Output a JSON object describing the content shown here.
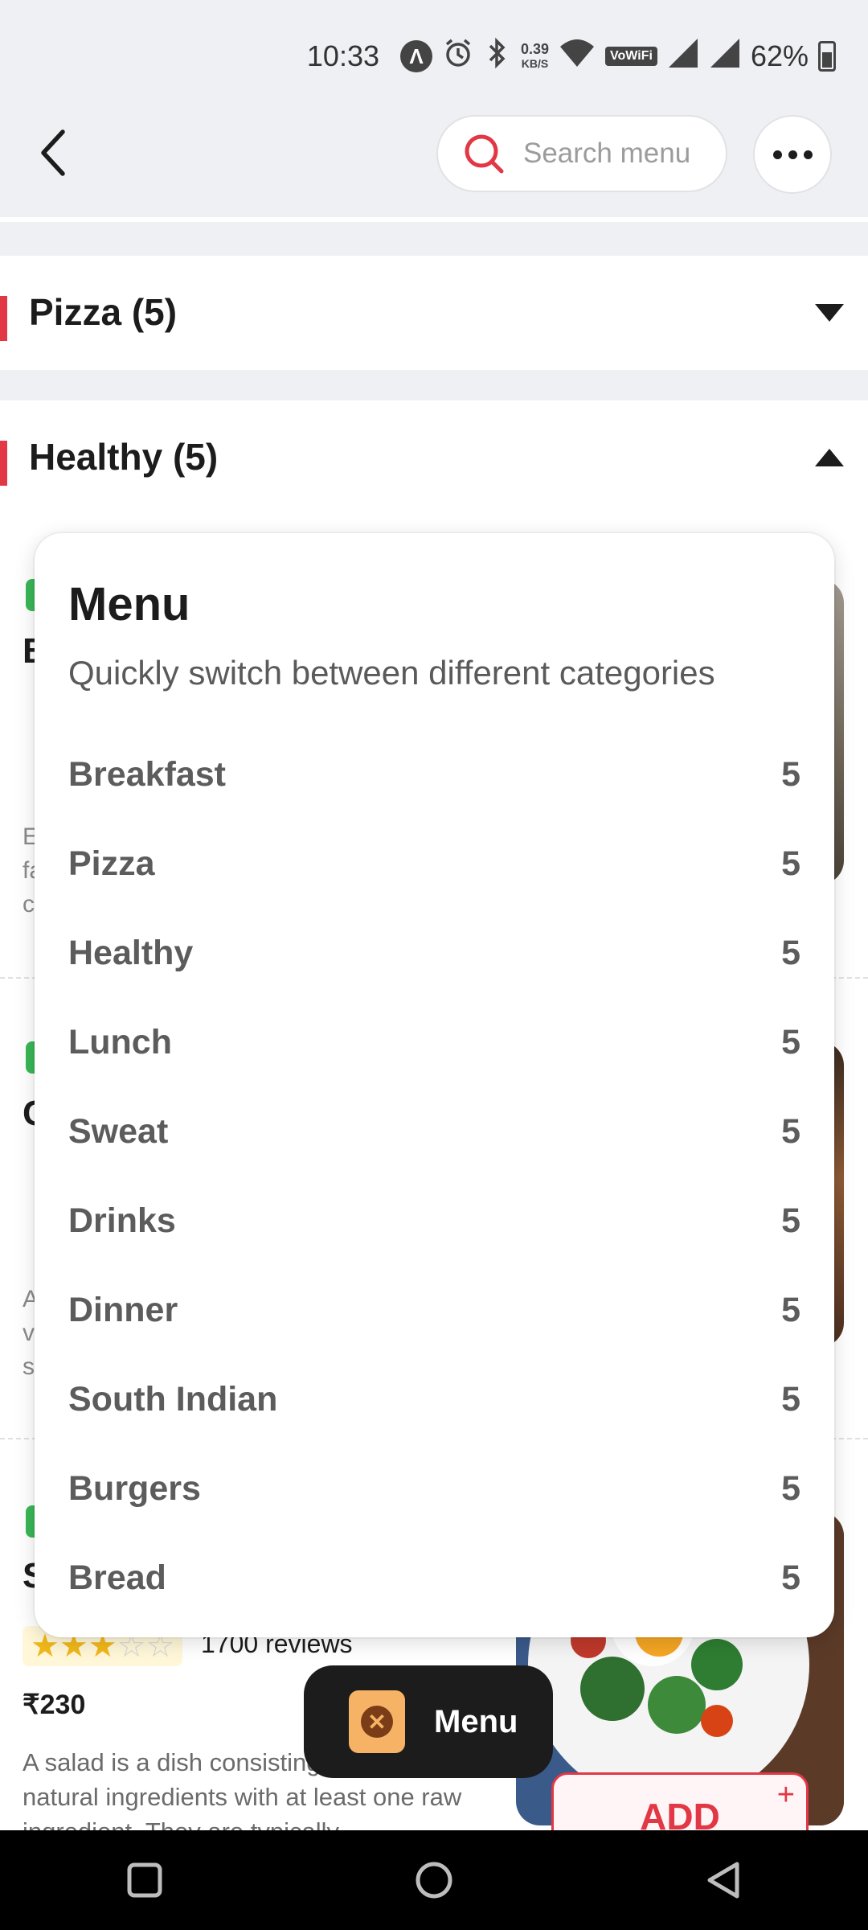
{
  "status_bar": {
    "time": "10:33",
    "net_speed_value": "0.39",
    "net_speed_unit": "KB/S",
    "wifi_label": "VoWiFi",
    "battery": "62%"
  },
  "header": {
    "search_placeholder": "Search menu"
  },
  "sections": [
    {
      "label": "Pizza (5)",
      "expanded": false
    },
    {
      "label": "Healthy (5)",
      "expanded": true
    }
  ],
  "background_items": [
    {
      "initial": "B",
      "text_initials": [
        "E",
        "fa",
        "c"
      ]
    },
    {
      "initial": "C",
      "text_initials": [
        "A",
        "v",
        "s"
      ]
    },
    {
      "initial": "S",
      "rating": 3,
      "reviews": "1700 reviews",
      "price": "₹230",
      "description": "A salad is a dish consisting mostly natural ingredients with at least one raw ingredient. They are typically",
      "add_label": "ADD",
      "add_plus": "+"
    }
  ],
  "menu_popup": {
    "title": "Menu",
    "subtitle": "Quickly switch between different categories",
    "categories": [
      {
        "name": "Breakfast",
        "count": "5"
      },
      {
        "name": "Pizza",
        "count": "5"
      },
      {
        "name": "Healthy",
        "count": "5"
      },
      {
        "name": "Lunch",
        "count": "5"
      },
      {
        "name": "Sweat",
        "count": "5"
      },
      {
        "name": "Drinks",
        "count": "5"
      },
      {
        "name": "Dinner",
        "count": "5"
      },
      {
        "name": "South Indian",
        "count": "5"
      },
      {
        "name": "Burgers",
        "count": "5"
      },
      {
        "name": "Bread",
        "count": "5"
      }
    ]
  },
  "floating_menu": {
    "label": "Menu",
    "icon": "close-icon"
  },
  "colors": {
    "accent": "#e23744",
    "veg_green": "#3ab757",
    "star": "#f2b81a"
  }
}
